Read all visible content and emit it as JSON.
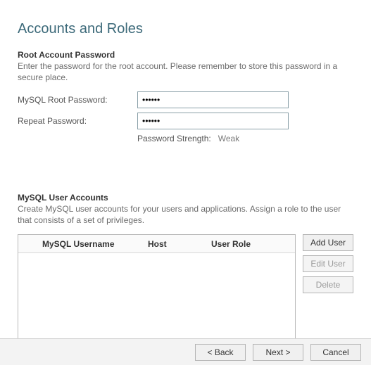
{
  "title": "Accounts and Roles",
  "root_account": {
    "heading": "Root Account Password",
    "description": "Enter the password for the root account.  Please remember to store this password in a secure place.",
    "password_label": "MySQL Root Password:",
    "password_value": "••••••",
    "repeat_label": "Repeat Password:",
    "repeat_value": "••••••",
    "strength_label": "Password Strength:",
    "strength_value": "Weak"
  },
  "user_accounts": {
    "heading": "MySQL User Accounts",
    "description": "Create MySQL user accounts for your users and applications. Assign a role to the user that consists of a set of privileges.",
    "columns": {
      "username": "MySQL Username",
      "host": "Host",
      "role": "User Role"
    },
    "rows": [],
    "buttons": {
      "add": "Add User",
      "edit": "Edit User",
      "delete": "Delete"
    }
  },
  "footer": {
    "back": "< Back",
    "next": "Next >",
    "cancel": "Cancel"
  }
}
